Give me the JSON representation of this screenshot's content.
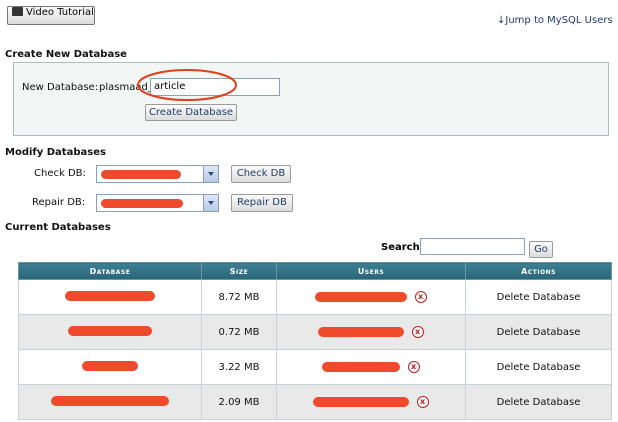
{
  "toolbar": {
    "video_tutorial_label": "Video Tutorial",
    "jump_link": "Jump to MySQL Users",
    "jump_arrow": "↓"
  },
  "create": {
    "title": "Create New Database",
    "label": "New Database:",
    "prefix": "plasmaad_",
    "value": "article",
    "button": "Create Database"
  },
  "modify": {
    "title": "Modify Databases",
    "check_label": "Check DB:",
    "check_button": "Check DB",
    "repair_label": "Repair DB:",
    "repair_button": "Repair DB"
  },
  "current": {
    "title": "Current Databases",
    "search_label": "Search",
    "search_value": "",
    "go_button": "Go"
  },
  "table": {
    "headers": [
      "Database",
      "Size",
      "Users",
      "Actions"
    ],
    "rows": [
      {
        "size": "8.72 MB",
        "action": "Delete Database"
      },
      {
        "size": "0.72 MB",
        "action": "Delete Database"
      },
      {
        "size": "3.22 MB",
        "action": "Delete Database"
      },
      {
        "size": "2.09 MB",
        "action": "Delete Database"
      }
    ]
  },
  "icons": {
    "remove_user": "x-circle-icon",
    "camera": "camera-icon"
  },
  "colors": {
    "redaction": "#f04a2c",
    "header": "#2f6f82",
    "annotation": "#e0401e"
  }
}
